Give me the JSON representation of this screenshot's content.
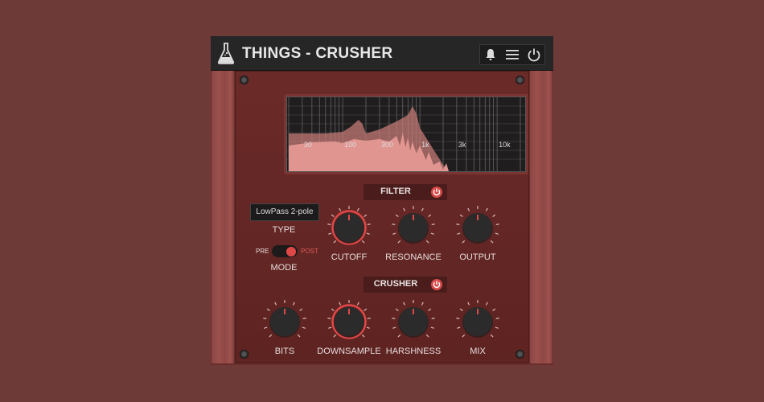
{
  "app": {
    "title": "THINGS - CRUSHER"
  },
  "header": {
    "buttons": [
      {
        "name": "notifications",
        "icon": "bell-icon"
      },
      {
        "name": "menu",
        "icon": "hamburger-menu-icon"
      },
      {
        "name": "power",
        "icon": "power-icon"
      }
    ]
  },
  "display": {
    "freq_labels": [
      "30",
      "100",
      "300",
      "1k",
      "3k",
      "10k"
    ],
    "colors": {
      "fill": "#d98a85",
      "background": "#1f1d1d",
      "grid": "#8a8a8a"
    }
  },
  "filter": {
    "section_label": "FILTER",
    "enabled": true,
    "type_label": "TYPE",
    "type_value": "LowPass 2-pole",
    "mode_label": "MODE",
    "mode_pre": "PRE",
    "mode_post": "POST",
    "mode_value": "POST",
    "knobs": [
      {
        "label": "CUTOFF",
        "highlighted": true,
        "value_fraction": 0.5
      },
      {
        "label": "RESONANCE",
        "highlighted": false,
        "value_fraction": 0.5
      },
      {
        "label": "OUTPUT",
        "highlighted": false,
        "value_fraction": 0.5
      }
    ]
  },
  "crusher": {
    "section_label": "CRUSHER",
    "enabled": true,
    "knobs": [
      {
        "label": "BITS",
        "highlighted": false,
        "value_fraction": 0.5
      },
      {
        "label": "DOWNSAMPLE",
        "highlighted": true,
        "value_fraction": 0.5
      },
      {
        "label": "HARSHNESS",
        "highlighted": false,
        "value_fraction": 0.5
      },
      {
        "label": "MIX",
        "highlighted": false,
        "value_fraction": 0.5
      }
    ]
  },
  "colors": {
    "accent": "#e04848",
    "panel": "#6a2a28",
    "header": "#262626"
  }
}
